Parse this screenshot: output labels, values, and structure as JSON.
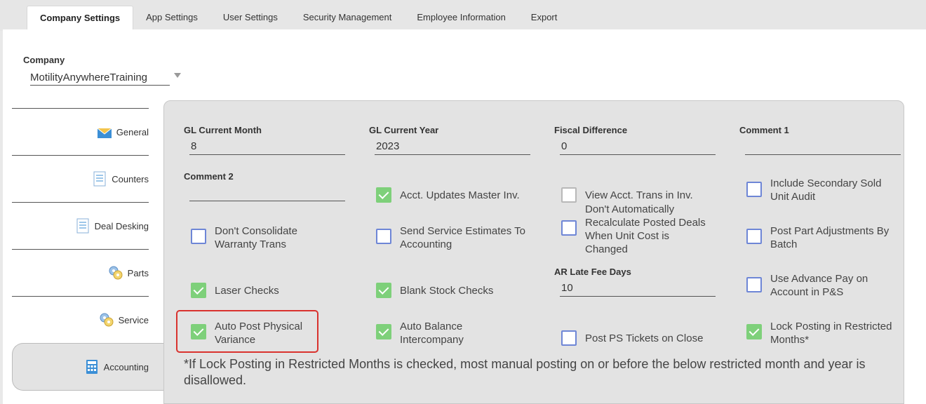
{
  "tabs": [
    {
      "label": "Company Settings",
      "active": true
    },
    {
      "label": "App Settings"
    },
    {
      "label": "User Settings"
    },
    {
      "label": "Security Management"
    },
    {
      "label": "Employee Information"
    },
    {
      "label": "Export"
    }
  ],
  "company": {
    "label": "Company",
    "value": "MotilityAnywhereTraining"
  },
  "sidenav": [
    {
      "label": "General",
      "icon": "envelope-icon"
    },
    {
      "label": "Counters",
      "icon": "document-icon"
    },
    {
      "label": "Deal Desking",
      "icon": "document-icon"
    },
    {
      "label": "Parts",
      "icon": "gears-icon"
    },
    {
      "label": "Service",
      "icon": "gears-icon"
    },
    {
      "label": "Accounting",
      "icon": "calculator-icon",
      "active": true
    }
  ],
  "fields": {
    "gl_month": {
      "label": "GL Current Month",
      "value": "8"
    },
    "gl_year": {
      "label": "GL Current Year",
      "value": "2023"
    },
    "fiscal_diff": {
      "label": "Fiscal Difference",
      "value": "0"
    },
    "comment1": {
      "label": "Comment 1",
      "value": ""
    },
    "comment2": {
      "label": "Comment 2",
      "value": ""
    },
    "ar_late_fee": {
      "label": "AR Late Fee Days",
      "value": "10"
    }
  },
  "checks": {
    "acct_updates": {
      "label": "Acct. Updates Master Inv.",
      "checked": true
    },
    "view_acct_trans": {
      "label": "View Acct. Trans in Inv.",
      "checked": false
    },
    "include_secondary": {
      "label": "Include Secondary Sold Unit Audit",
      "checked": false
    },
    "dont_consolidate": {
      "label": "Don't Consolidate Warranty Trans",
      "checked": false
    },
    "send_service": {
      "label": "Send Service Estimates To Accounting",
      "checked": false
    },
    "dont_recalc": {
      "label": "Don't Automatically Recalculate Posted Deals When Unit Cost is Changed",
      "checked": false
    },
    "post_part_adj": {
      "label": "Post Part Adjustments By Batch",
      "checked": false
    },
    "laser_checks": {
      "label": "Laser Checks",
      "checked": true
    },
    "blank_stock": {
      "label": "Blank Stock Checks",
      "checked": true
    },
    "use_advance": {
      "label": "Use Advance Pay on Account in P&S",
      "checked": false
    },
    "auto_post": {
      "label": "Auto Post Physical Variance",
      "checked": true
    },
    "auto_balance": {
      "label": "Auto Balance Intercompany",
      "checked": true
    },
    "post_ps": {
      "label": "Post PS Tickets on Close",
      "checked": false
    },
    "lock_posting": {
      "label": "Lock Posting in Restricted Months*",
      "checked": true
    }
  },
  "note": "*If Lock Posting in Restricted Months is checked, most manual posting on or before the below restricted month and year is disallowed.",
  "colors": {
    "checked": "#7ed07a",
    "unchecked_border": "#6e86d6",
    "highlight": "#d9322e"
  }
}
